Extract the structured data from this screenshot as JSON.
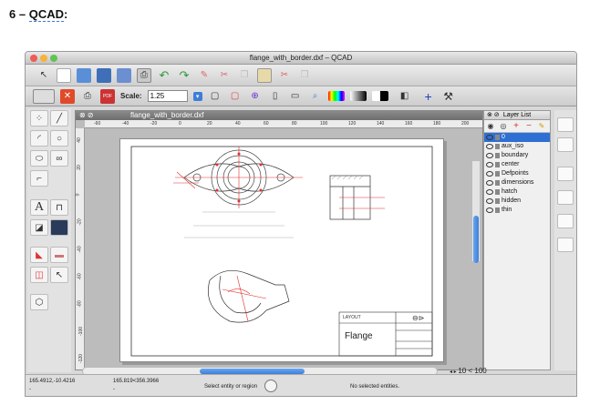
{
  "heading": {
    "number": "6 –",
    "title": "QCAD",
    "suffix": ":"
  },
  "window": {
    "title": "flange_with_border.dxf – QCAD"
  },
  "toolbar2": {
    "scale_label": "Scale:",
    "scale_value": "1.25"
  },
  "document": {
    "title": "flange_with_border.dxf",
    "ruler_ticks_h": [
      "-60",
      "-40",
      "-20",
      "0",
      "20",
      "40",
      "60",
      "80",
      "100",
      "120",
      "140",
      "160",
      "180",
      "200"
    ],
    "ruler_ticks_v": [
      "40",
      "20",
      "0",
      "-20",
      "-40",
      "-60",
      "-80",
      "-100",
      "-120"
    ]
  },
  "title_block": {
    "name": "Flange",
    "label": "LAYOUT"
  },
  "layer_panel": {
    "title": "Layer List",
    "layers": [
      {
        "name": "0",
        "selected": true
      },
      {
        "name": "aux_iso",
        "selected": false
      },
      {
        "name": "boundary",
        "selected": false
      },
      {
        "name": "center",
        "selected": false
      },
      {
        "name": "Defpoints",
        "selected": false
      },
      {
        "name": "dimensions",
        "selected": false
      },
      {
        "name": "hatch",
        "selected": false
      },
      {
        "name": "hidden",
        "selected": false
      },
      {
        "name": "thin",
        "selected": false
      }
    ]
  },
  "pager": {
    "text": "10 < 100"
  },
  "status": {
    "abs_coord": "165.4912,-10.4216",
    "rel_coord": "165.819<356.3966",
    "prompt": "Select entity or region",
    "selection": "No selected entities.",
    "dash": "-"
  },
  "colors": {
    "accent": "#3d7ed8",
    "drawing_red": "#e03030",
    "layer_selected": "#2e6fd4"
  }
}
